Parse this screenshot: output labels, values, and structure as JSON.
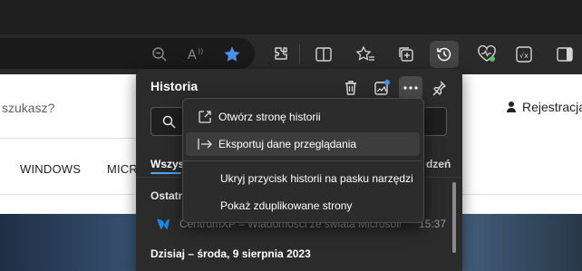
{
  "page": {
    "search_placeholder": "szukasz?",
    "register_label": "Rejestracja A",
    "nav_items": [
      "WINDOWS",
      "MICR"
    ]
  },
  "history": {
    "title": "Historia",
    "tab_all": "Wszys",
    "tab_right": "dzeń",
    "group_label_1": "Ostatn",
    "entry": {
      "title": "CentrumXP – Wiadomości ze świata Microsoft ...",
      "time": "15:37"
    },
    "group_label_2": "Dzisiaj – środa, 9 sierpnia 2023"
  },
  "menu": {
    "items": [
      {
        "label": "Otwórz stronę historii"
      },
      {
        "label": "Eksportuj dane przeglądania"
      },
      {
        "label": "Ukryj przycisk historii na pasku narzędzi"
      },
      {
        "label": "Pokaż zduplikowane strony"
      }
    ]
  },
  "colors": {
    "accent": "#4fa3ff",
    "favorite_star": "#4a8fe8",
    "status_green": "#5cc36b"
  }
}
